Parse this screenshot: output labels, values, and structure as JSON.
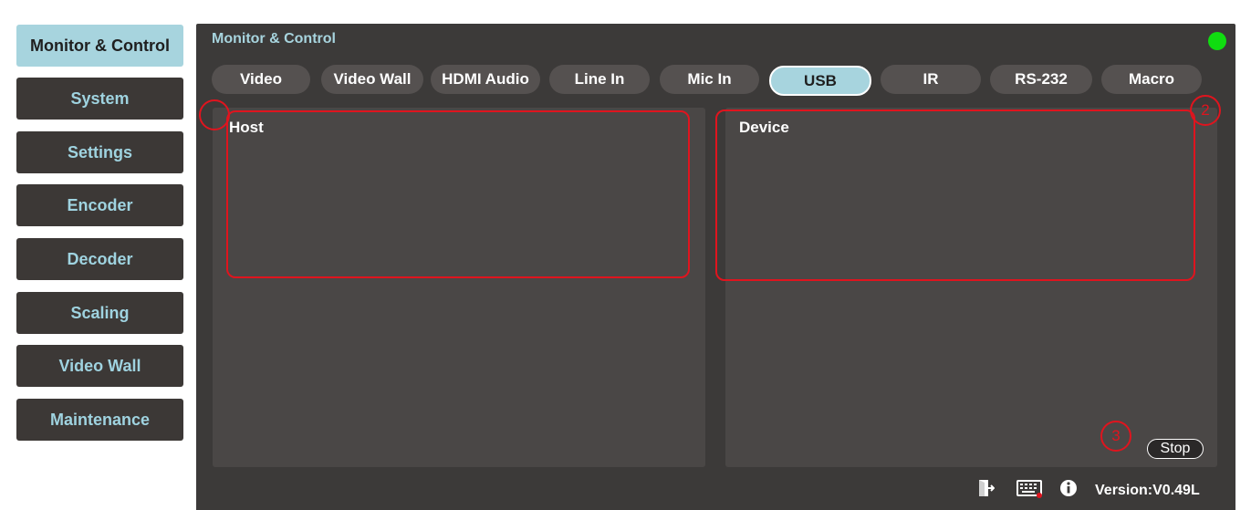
{
  "sidebar": {
    "items": [
      {
        "label": "Monitor & Control"
      },
      {
        "label": "System"
      },
      {
        "label": "Settings"
      },
      {
        "label": "Encoder"
      },
      {
        "label": "Decoder"
      },
      {
        "label": "Scaling"
      },
      {
        "label": "Video Wall"
      },
      {
        "label": "Maintenance"
      }
    ],
    "active_index": 0
  },
  "main": {
    "title": "Monitor & Control",
    "tabs": [
      {
        "label": "Video"
      },
      {
        "label": "Video Wall"
      },
      {
        "label": "HDMI Audio"
      },
      {
        "label": "Line In"
      },
      {
        "label": "Mic In"
      },
      {
        "label": "USB"
      },
      {
        "label": "IR"
      },
      {
        "label": "RS-232"
      },
      {
        "label": "Macro"
      }
    ],
    "active_tab": "USB",
    "host_panel": {
      "title": "Host"
    },
    "device_panel": {
      "title": "Device"
    },
    "stop_label": "Stop"
  },
  "annotations": {
    "markers": [
      {
        "label": "1"
      },
      {
        "label": "2"
      },
      {
        "label": "3"
      }
    ]
  },
  "footer": {
    "version": "Version:V0.49L",
    "icons": [
      "logout-icon",
      "keyboard-icon",
      "info-icon"
    ]
  },
  "colors": {
    "accent": "#a7d4de",
    "sidebar_button": "#3c3836",
    "panel_background": "#3c3a39",
    "status_online": "#10dc10",
    "annotation_red": "#e0141e"
  }
}
